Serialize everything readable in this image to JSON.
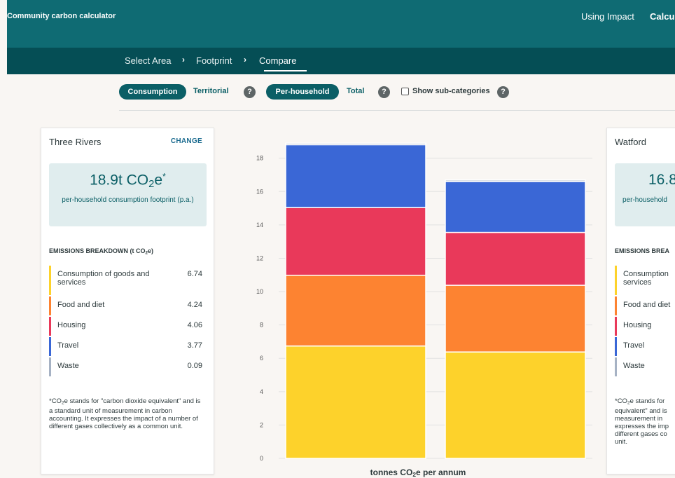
{
  "header": {
    "title": "Community carbon calculator",
    "nav": [
      "Using Impact",
      "Calcul"
    ]
  },
  "steps": [
    {
      "label": "Select Area",
      "active": false
    },
    {
      "label": "Footprint",
      "active": false
    },
    {
      "label": "Compare",
      "active": true
    }
  ],
  "toggles": {
    "consumption": "Consumption",
    "territorial": "Territorial",
    "per_household": "Per-household",
    "total": "Total",
    "help": "?",
    "show_sub": "Show sub-categories"
  },
  "left_card": {
    "area": "Three Rivers",
    "change": "CHANGE",
    "value": "18.9t",
    "unit_prefix": "CO",
    "unit_sub": "2",
    "unit_suffix": "e",
    "asterisk": "*",
    "caption": "per-household consumption footprint (p.a.)",
    "breakdown_title_a": "EMISSIONS BREAKDOWN (t CO",
    "breakdown_title_sub": "2",
    "breakdown_title_b": "e)",
    "breakdown": [
      {
        "label": "Consumption of goods and services",
        "value": "6.74",
        "color": "#fdd22b"
      },
      {
        "label": "Food and diet",
        "value": "4.24",
        "color": "#fd8331"
      },
      {
        "label": "Housing",
        "value": "4.06",
        "color": "#e9395a"
      },
      {
        "label": "Travel",
        "value": "3.77",
        "color": "#3a67d6"
      },
      {
        "label": "Waste",
        "value": "0.09",
        "color": "#a6b2c4"
      }
    ],
    "footnote_a": "*CO",
    "footnote_sub": "2",
    "footnote_b": "e stands for \"carbon dioxide equivalent\" and is a standard unit of measurement in carbon accounting. It expresses the impact of a number of different gases collectively as a common unit."
  },
  "right_card": {
    "area": "Watford",
    "value": "16.8",
    "caption": "per-household",
    "breakdown_title": "EMISSIONS BREA",
    "breakdown": [
      {
        "label": "Consumption services",
        "color": "#fdd22b"
      },
      {
        "label": "Food and diet",
        "color": "#fd8331"
      },
      {
        "label": "Housing",
        "color": "#e9395a"
      },
      {
        "label": "Travel",
        "color": "#3a67d6"
      },
      {
        "label": "Waste",
        "color": "#a6b2c4"
      }
    ],
    "footnote_a": "*CO",
    "footnote_sub": "2",
    "footnote_b": "e stands for equivalent\" and is measurement in expresses the imp different gases co unit."
  },
  "chart_data": {
    "type": "bar",
    "stacked": true,
    "categories": [
      "Three Rivers",
      "Watford"
    ],
    "series": [
      {
        "name": "Consumption of goods and services",
        "color": "#fdd22b",
        "values": [
          6.74,
          6.38
        ]
      },
      {
        "name": "Food and diet",
        "color": "#fd8331",
        "values": [
          4.24,
          4.0
        ]
      },
      {
        "name": "Housing",
        "color": "#e9395a",
        "values": [
          4.06,
          3.17
        ]
      },
      {
        "name": "Travel",
        "color": "#3a67d6",
        "values": [
          3.77,
          3.05
        ]
      },
      {
        "name": "Waste",
        "color": "#a6b2c4",
        "values": [
          0.09,
          0.09
        ]
      }
    ],
    "yticks": [
      0,
      2,
      4,
      6,
      8,
      10,
      12,
      14,
      16,
      18
    ],
    "ylim": [
      0,
      19.5
    ],
    "xlabel_a": "tonnes CO",
    "xlabel_sub": "2",
    "xlabel_b": "e per annum",
    "grid": true
  }
}
